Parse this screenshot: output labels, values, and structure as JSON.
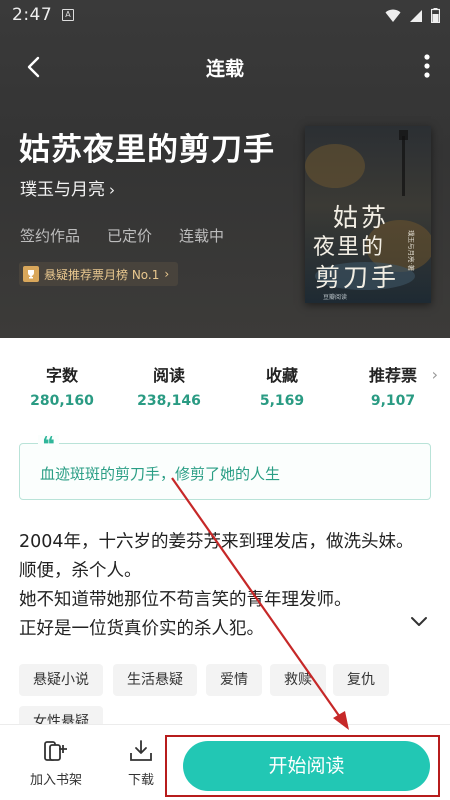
{
  "status_bar": {
    "time": "2:47",
    "notification_glyph": "A"
  },
  "nav": {
    "title": "连载"
  },
  "book": {
    "title": "姑苏夜里的剪刀手",
    "author": "璞玉与月亮",
    "meta": [
      "签约作品",
      "已定价",
      "连载中"
    ],
    "rank_badge": "悬疑推荐票月榜 No.1",
    "cover": {
      "title_chars": [
        "姑",
        "苏",
        "夜",
        "里",
        "的",
        "剪",
        "刀",
        "手"
      ],
      "side_text": "璞玉与月亮·著",
      "publisher": "豆瓣阅读"
    }
  },
  "stats": [
    {
      "label": "字数",
      "value": "280,160"
    },
    {
      "label": "阅读",
      "value": "238,146"
    },
    {
      "label": "收藏",
      "value": "5,169"
    },
    {
      "label": "推荐票",
      "value": "9,107"
    }
  ],
  "quote": {
    "mark": "❝",
    "text": "血迹斑斑的剪刀手，修剪了她的人生"
  },
  "synopsis": [
    "2004年，十六岁的姜芬芳来到理发店，做洗头妹。",
    "顺便，杀个人。",
    "她不知道带她那位不苟言笑的青年理发师。",
    "正好是一位货真价实的杀人犯。"
  ],
  "tags": [
    "悬疑小说",
    "生活悬疑",
    "爱情",
    "救赎",
    "复仇",
    "女性悬疑"
  ],
  "bottom_bar": {
    "add_shelf_label": "加入书架",
    "download_label": "下载",
    "start_label": "开始阅读"
  },
  "colors": {
    "accent": "#22c7b4",
    "stat_value": "#2a9b83",
    "highlight_box": "#b71c1c",
    "annotation_arrow": "#c62828"
  }
}
